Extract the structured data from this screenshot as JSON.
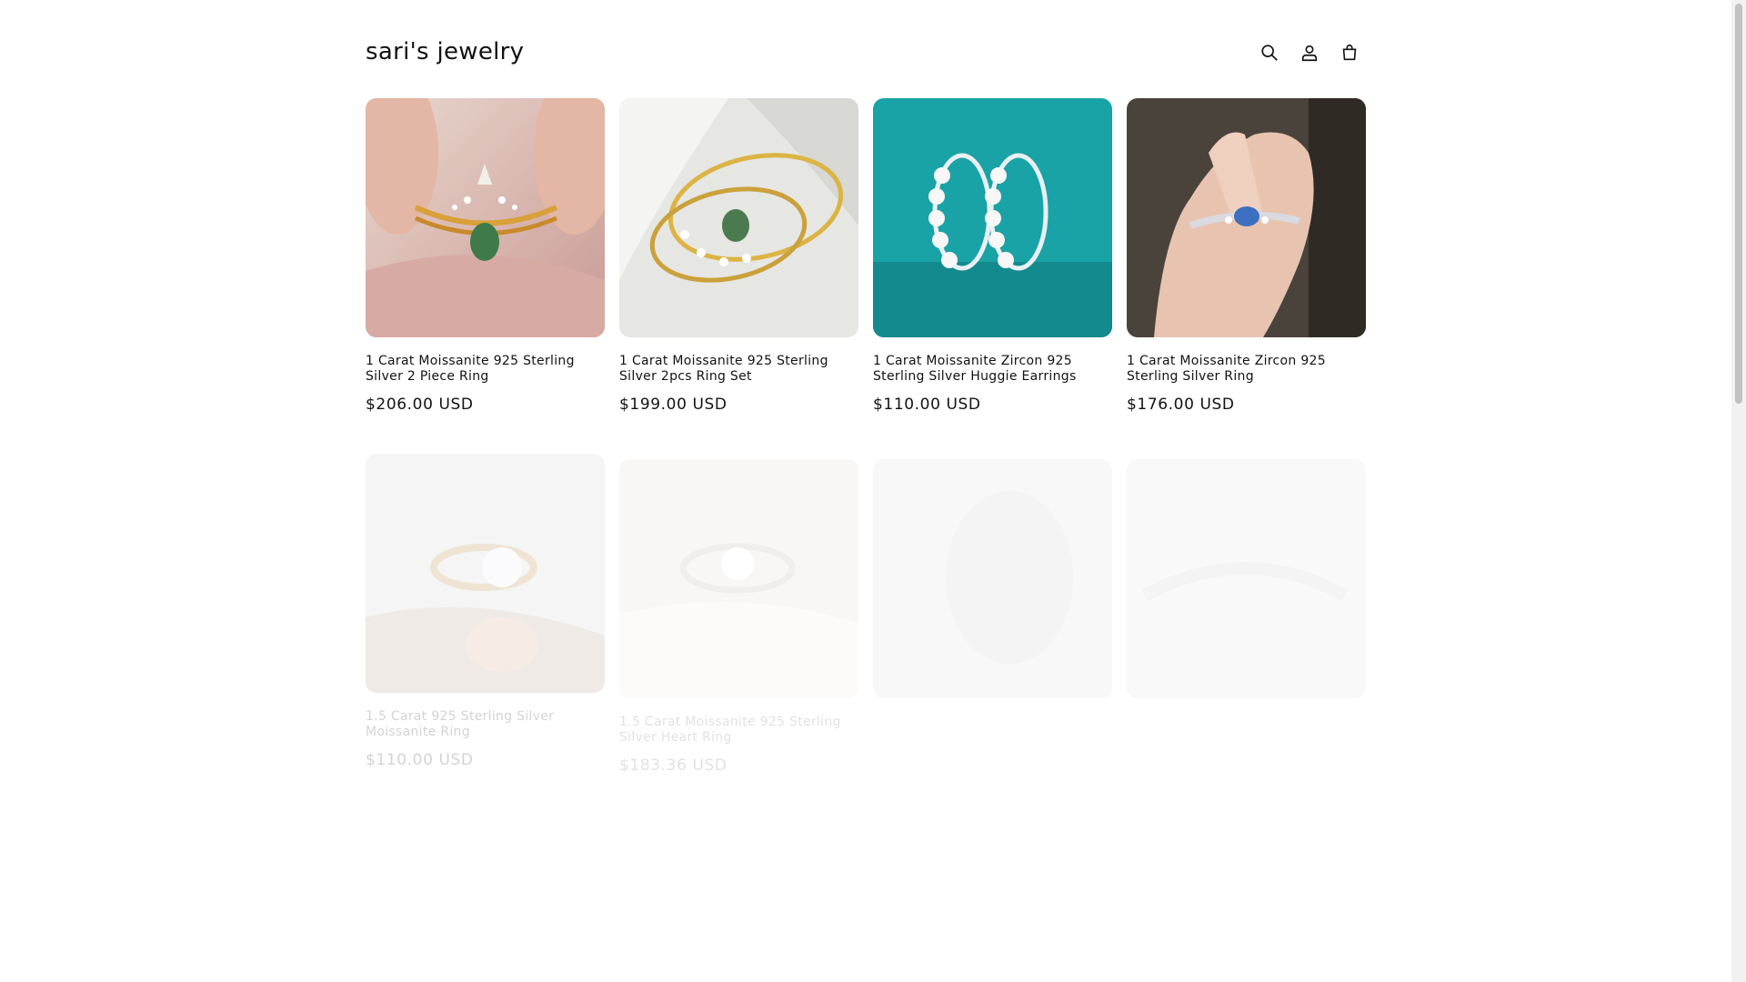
{
  "header": {
    "logo": "sari's jewelry",
    "icons": [
      "search-icon",
      "account-icon",
      "cart-icon"
    ]
  },
  "products": [
    {
      "title": "1 Carat Moissanite 925 Sterling Silver 2 Piece Ring",
      "price": "$206.00 USD"
    },
    {
      "title": "1 Carat Moissanite 925 Sterling Silver 2pcs Ring Set",
      "price": "$199.00 USD"
    },
    {
      "title": "1 Carat Moissanite Zircon 925 Sterling Silver Huggie Earrings",
      "price": "$110.00 USD"
    },
    {
      "title": "1 Carat Moissanite Zircon 925 Sterling Silver Ring",
      "price": "$176.00 USD"
    },
    {
      "title": "1.5 Carat 925 Sterling Silver Moissanite Ring",
      "price": "$110.00 USD"
    },
    {
      "title": "1.5 Carat Moissanite 925 Sterling Silver Heart Ring",
      "price": "$183.36 USD"
    }
  ],
  "colors": {
    "text": "#121212",
    "earring_bg": "#1aa3a6"
  }
}
